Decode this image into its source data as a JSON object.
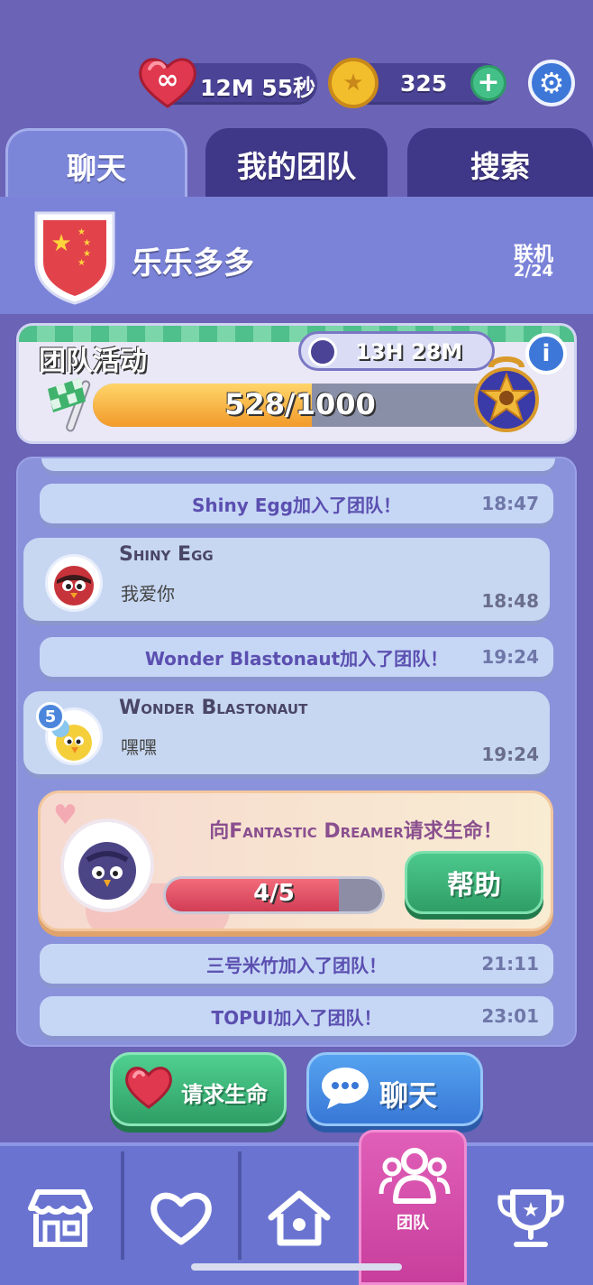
{
  "top_bar": {
    "lives_timer": "12M 55秒",
    "coins": "325"
  },
  "tabs": [
    {
      "label": "聊天"
    },
    {
      "label": "我的团队"
    },
    {
      "label": "搜索"
    }
  ],
  "team": {
    "name": "乐乐多多",
    "online_label": "联机",
    "online_count": "2/24"
  },
  "event": {
    "title": "团队活动",
    "timer": "13H 28M",
    "progress_text": "528/1000",
    "progress_value": 0.528
  },
  "chat": {
    "system_1": {
      "text": "Shiny Egg加入了团队！",
      "time": "18:47"
    },
    "message_1": {
      "name": "Shiny Egg",
      "text": "我爱你",
      "time": "18:48"
    },
    "system_2": {
      "text": "Wonder Blastonaut加入了团队！",
      "time": "19:24"
    },
    "message_2": {
      "name": "Wonder Blastonaut",
      "text": "嘿嘿",
      "time": "19:24",
      "level": "5"
    },
    "life_request": {
      "text": "向Fantastic Dreamer请求生命！",
      "progress_text": "4/5",
      "progress_value": 0.8,
      "help_label": "帮助"
    },
    "system_3": {
      "text": "三号米竹加入了团队！",
      "time": "21:11"
    },
    "system_4": {
      "text": "TOPUI加入了团队！",
      "time": "23:01"
    }
  },
  "actions": {
    "request_lives_label": "请求生命",
    "chat_label": "聊天"
  },
  "bottom_nav": {
    "items": [
      {
        "icon": "shop-icon"
      },
      {
        "icon": "heart-icon"
      },
      {
        "icon": "home-icon"
      },
      {
        "icon": "team-icon",
        "label": "团队",
        "active": true
      },
      {
        "icon": "trophy-icon"
      }
    ]
  },
  "colors": {
    "background": "#6a63b6",
    "active_nav": "#d047a6",
    "green_button": "#36b26e",
    "blue_button": "#3f86e0"
  }
}
